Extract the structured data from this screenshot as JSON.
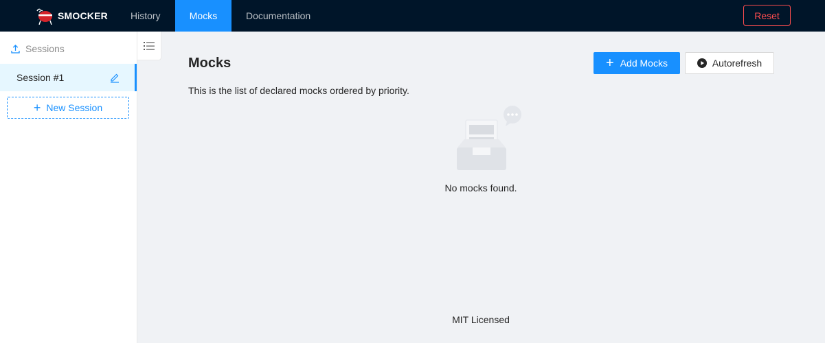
{
  "app": {
    "brand": "SMOCKER",
    "logo_icon": "bbq-grill-icon"
  },
  "nav": {
    "items": [
      {
        "label": "History",
        "active": false
      },
      {
        "label": "Mocks",
        "active": true
      },
      {
        "label": "Documentation",
        "active": false
      }
    ]
  },
  "header": {
    "reset_label": "Reset"
  },
  "sidebar": {
    "sessions_label": "Sessions",
    "sessions": [
      {
        "label": "Session #1",
        "selected": true
      }
    ],
    "new_session_label": "New Session"
  },
  "main": {
    "title": "Mocks",
    "add_label": "Add Mocks",
    "autorefresh_label": "Autorefresh",
    "subtitle": "This is the list of declared mocks ordered by priority.",
    "empty_text": "No mocks found."
  },
  "footer": {
    "text": "MIT Licensed"
  },
  "colors": {
    "primary": "#1890ff",
    "header_bg": "#001529",
    "danger": "#ff4d4f",
    "page_bg": "#f0f2f5"
  }
}
